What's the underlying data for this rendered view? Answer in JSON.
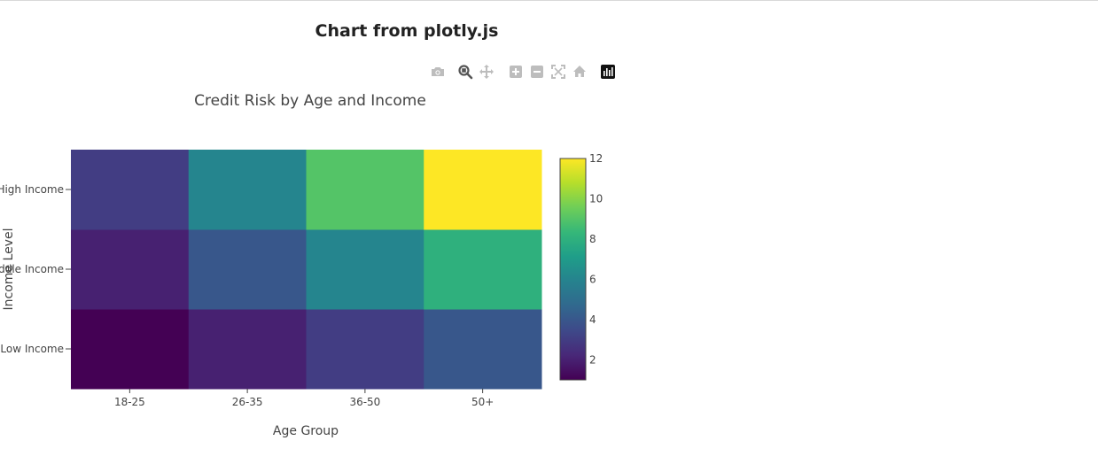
{
  "page": {
    "title": "Chart from plotly.js"
  },
  "modebar": {
    "buttons": [
      {
        "name": "camera-icon",
        "label": "Download plot as a png",
        "active": false
      },
      {
        "name": "zoom-icon",
        "label": "Zoom",
        "active": true
      },
      {
        "name": "pan-icon",
        "label": "Pan",
        "active": false
      },
      {
        "name": "zoom-in-icon",
        "label": "Zoom in",
        "active": false
      },
      {
        "name": "zoom-out-icon",
        "label": "Zoom out",
        "active": false
      },
      {
        "name": "autoscale-icon",
        "label": "Autoscale",
        "active": false
      },
      {
        "name": "home-icon",
        "label": "Reset axes",
        "active": false
      },
      {
        "name": "plotly-logo-icon",
        "label": "Produced with Plotly",
        "active": false
      }
    ]
  },
  "chart_data": {
    "type": "heatmap",
    "title": "Credit Risk by Age and Income",
    "xlabel": "Age Group",
    "ylabel": "Income Level",
    "x": [
      "18-25",
      "26-35",
      "36-50",
      "50+"
    ],
    "y": [
      "Low Income",
      "Middle Income",
      "High Income"
    ],
    "z": [
      [
        1,
        2,
        3,
        4
      ],
      [
        2,
        4,
        6,
        8
      ],
      [
        3,
        6,
        9,
        12
      ]
    ],
    "zrange": [
      1,
      12
    ],
    "colorscale": "Viridis",
    "colorbar_ticks": [
      2,
      4,
      6,
      8,
      10,
      12
    ],
    "colors": [
      "#440154",
      "#482878",
      "#3e4989",
      "#31688e",
      "#26828e",
      "#1f9e89",
      "#35b779",
      "#6ece58",
      "#b5de2b",
      "#fde725"
    ]
  }
}
